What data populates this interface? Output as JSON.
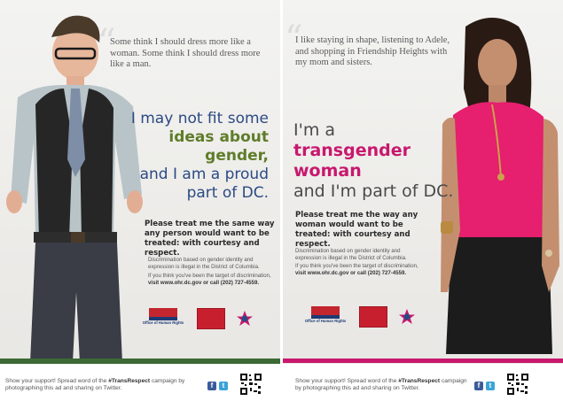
{
  "left_ad": {
    "quote": "Some think I should dress more like a woman. Some think I should dress more like a man.",
    "headline_line1": "I may not fit some",
    "headline_highlight": "ideas about gender,",
    "headline_line3": "and I am a proud",
    "headline_line4": "part of DC.",
    "ask": "Please treat me the same way any person would want to be treated: with courtesy and respect.",
    "fine_print_1": "Discrimination based on gender identity and expression is illegal in the District of Columbia.",
    "fine_print_2": "If you think you've been the target of discrimination,",
    "fine_print_contact": "visit www.ohr.dc.gov or call (202) 727-4559.",
    "logo_ohr_text": "Office of Human Rights",
    "accent_color": "#3c6a34"
  },
  "right_ad": {
    "quote": "I like staying in shape, listening to Adele, and shopping in Friendship Heights with my mom and sisters.",
    "headline_line1": "I'm a",
    "headline_highlight": "transgender woman",
    "headline_line3": "and I'm part of DC.",
    "ask": "Please treat me the way any woman would want to be treated: with courtesy and respect.",
    "fine_print_1": "Discrimination based on gender identity and expression is illegal in the District of Columbia.",
    "fine_print_2": "If you think you've been the target of discrimination,",
    "fine_print_contact": "visit www.ohr.dc.gov or call (202) 727-4559.",
    "logo_ohr_text": "Office of Human Rights",
    "accent_color": "#c8186e"
  },
  "footer": {
    "text_before": "Show your support! Spread word of the",
    "hashtag": "#TransRespect",
    "text_after": "campaign by photographing this ad and sharing on Twitter.",
    "icons": [
      "facebook-icon",
      "twitter-icon",
      "qr-code-icon"
    ]
  }
}
